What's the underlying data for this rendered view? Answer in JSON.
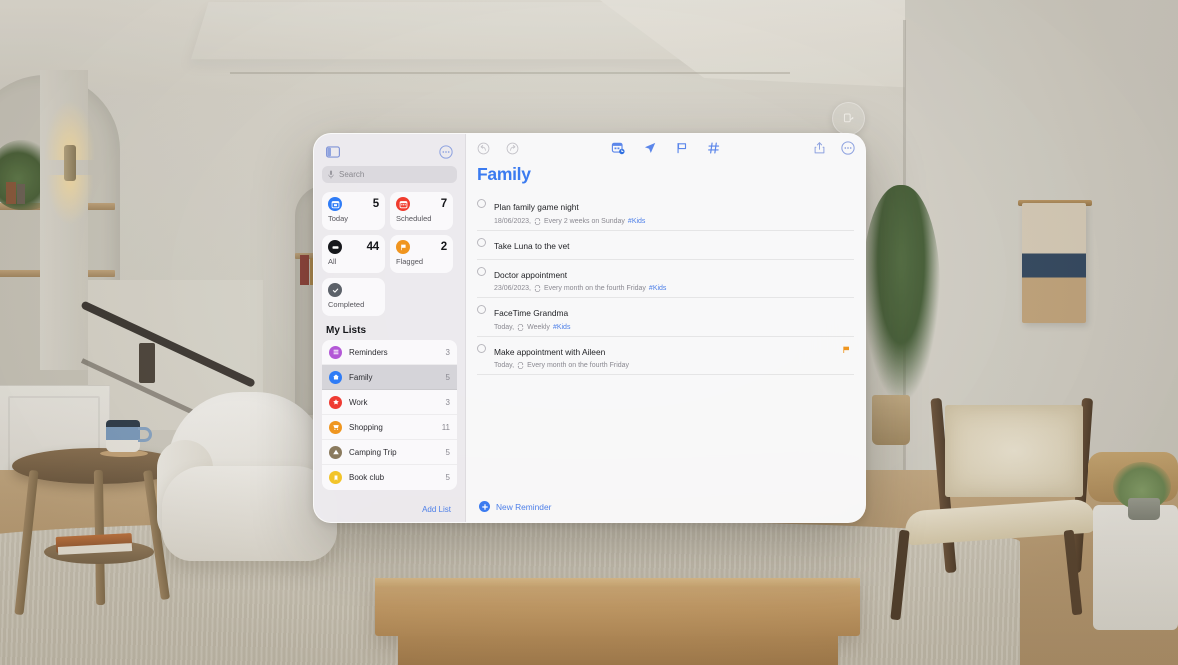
{
  "environment": {
    "scene": "living-room-passthrough",
    "float_button_icon": "window-resize-icon"
  },
  "window": {
    "sidebar": {
      "toggle_icon": "sidebar-toggle-icon",
      "more_icon": "more-circle-icon",
      "search": {
        "placeholder": "Search",
        "mic_icon": "microphone-icon",
        "value": ""
      },
      "smart_lists": [
        {
          "label": "Today",
          "count": "5",
          "icon": "calendar-icon",
          "color": "#2f7cf6"
        },
        {
          "label": "Scheduled",
          "count": "7",
          "icon": "calendar-days-icon",
          "color": "#f03c2e"
        },
        {
          "label": "All",
          "count": "44",
          "icon": "tray-icon",
          "color": "#17181c"
        },
        {
          "label": "Flagged",
          "count": "2",
          "icon": "flag-icon",
          "color": "#f0951f"
        },
        {
          "label": "Completed",
          "count": "",
          "icon": "checkmark-icon",
          "color": "#5c6169"
        }
      ],
      "my_lists_header": "My Lists",
      "lists": [
        {
          "label": "Reminders",
          "count": "3",
          "icon": "list-bullet-icon",
          "color": "#b358d6",
          "selected": false
        },
        {
          "label": "Family",
          "count": "5",
          "icon": "house-icon",
          "color": "#2f7cf6",
          "selected": true
        },
        {
          "label": "Work",
          "count": "3",
          "icon": "star-icon",
          "color": "#ef3b33",
          "selected": false
        },
        {
          "label": "Shopping",
          "count": "11",
          "icon": "cart-icon",
          "color": "#ef9620",
          "selected": false
        },
        {
          "label": "Camping Trip",
          "count": "5",
          "icon": "tent-icon",
          "color": "#8a7a5e",
          "selected": false
        },
        {
          "label": "Book club",
          "count": "5",
          "icon": "bookmark-icon",
          "color": "#f2c42a",
          "selected": false
        }
      ],
      "add_list_label": "Add List"
    },
    "content": {
      "toolbar": {
        "left": [
          {
            "icon": "undo-icon",
            "enabled": false
          },
          {
            "icon": "redo-icon",
            "enabled": false
          }
        ],
        "center": [
          {
            "icon": "add-date-icon"
          },
          {
            "icon": "location-icon"
          },
          {
            "icon": "flag-outline-icon"
          },
          {
            "icon": "hashtag-tag-icon"
          }
        ],
        "right": [
          {
            "icon": "share-icon"
          },
          {
            "icon": "more-circle-icon"
          }
        ]
      },
      "title": "Family",
      "title_color": "#3b7bf0",
      "reminders": [
        {
          "title": "Plan family game night",
          "date": "18/06/2023,",
          "repeat_icon": "repeat-icon",
          "repeat": "Every 2 weeks on Sunday",
          "tag": "#Kids",
          "flagged": false,
          "completed": false
        },
        {
          "title": "Take Luna to the vet",
          "date": "",
          "repeat_icon": "",
          "repeat": "",
          "tag": "",
          "flagged": false,
          "completed": false
        },
        {
          "title": "Doctor appointment",
          "date": "23/06/2023,",
          "repeat_icon": "repeat-icon",
          "repeat": "Every month on the fourth Friday",
          "tag": "#Kids",
          "flagged": false,
          "completed": false
        },
        {
          "title": "FaceTime Grandma",
          "date": "Today,",
          "repeat_icon": "repeat-icon",
          "repeat": "Weekly",
          "tag": "#Kids",
          "flagged": false,
          "completed": false
        },
        {
          "title": "Make appointment with Aileen",
          "date": "Today,",
          "repeat_icon": "repeat-icon",
          "repeat": "Every month on the fourth Friday",
          "tag": "",
          "flagged": true,
          "flag_color": "#ef9620",
          "completed": false
        }
      ],
      "new_reminder_label": "New Reminder",
      "new_reminder_icon": "plus-circle-icon"
    }
  }
}
